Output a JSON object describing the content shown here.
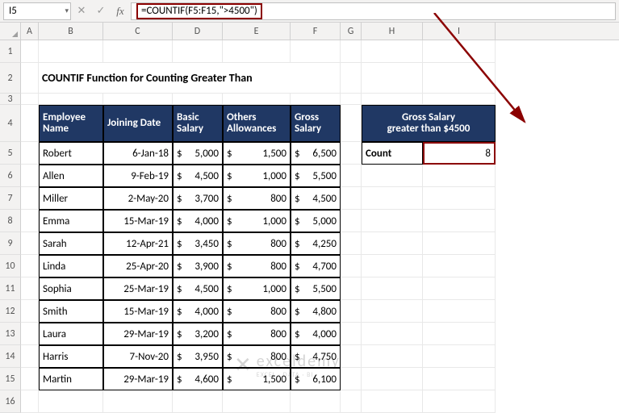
{
  "formula_bar": {
    "cell_ref": "I5",
    "formula": "=COUNTIF(F5:F15,\">4500\")",
    "cancel_icon": "✕",
    "check_icon": "✓",
    "fx_label": "fx"
  },
  "columns": [
    "A",
    "B",
    "C",
    "D",
    "E",
    "F",
    "G",
    "H",
    "I"
  ],
  "row_numbers": [
    "1",
    "2",
    "3",
    "4",
    "5",
    "6",
    "7",
    "8",
    "9",
    "10",
    "11",
    "12",
    "13",
    "14",
    "15",
    "16"
  ],
  "title": "COUNTIF Function for Counting Greater Than",
  "table": {
    "headers": {
      "name": "Employee Name",
      "date": "Joining Date",
      "basic": "Basic Salary",
      "allow": "Others Allowances",
      "gross": "Gross Salary"
    },
    "rows": [
      {
        "name": "Robert",
        "date": "6-Jan-18",
        "basic": "5,000",
        "allow": "1,500",
        "gross": "6,500"
      },
      {
        "name": "Allen",
        "date": "9-Feb-19",
        "basic": "4,500",
        "allow": "1,000",
        "gross": "5,500"
      },
      {
        "name": "Miller",
        "date": "2-May-20",
        "basic": "3,700",
        "allow": "800",
        "gross": "4,500"
      },
      {
        "name": "Emma",
        "date": "15-Mar-19",
        "basic": "4,000",
        "allow": "1,000",
        "gross": "5,000"
      },
      {
        "name": "Sarah",
        "date": "12-Apr-21",
        "basic": "3,450",
        "allow": "800",
        "gross": "4,250"
      },
      {
        "name": "Linda",
        "date": "25-Apr-20",
        "basic": "3,900",
        "allow": "800",
        "gross": "4,700"
      },
      {
        "name": "Sophia",
        "date": "25-Mar-19",
        "basic": "4,500",
        "allow": "1,000",
        "gross": "5,500"
      },
      {
        "name": "Smith",
        "date": "15-Mar-19",
        "basic": "4,000",
        "allow": "800",
        "gross": "4,800"
      },
      {
        "name": "Laura",
        "date": "29-Mar-19",
        "basic": "3,200",
        "allow": "800",
        "gross": "4,000"
      },
      {
        "name": "Harris",
        "date": "7-Nov-20",
        "basic": "3,950",
        "allow": "800",
        "gross": "4,750"
      },
      {
        "name": "Martin",
        "date": "29-Mar-19",
        "basic": "4,600",
        "allow": "1,500",
        "gross": "6,100"
      }
    ]
  },
  "summary": {
    "header_l1": "Gross Salary",
    "header_l2": "greater than $4500",
    "count_label": "Count",
    "count_value": "8"
  },
  "watermark": {
    "main": "exceldemy",
    "sub": "EXCEL · DATA · BI"
  }
}
